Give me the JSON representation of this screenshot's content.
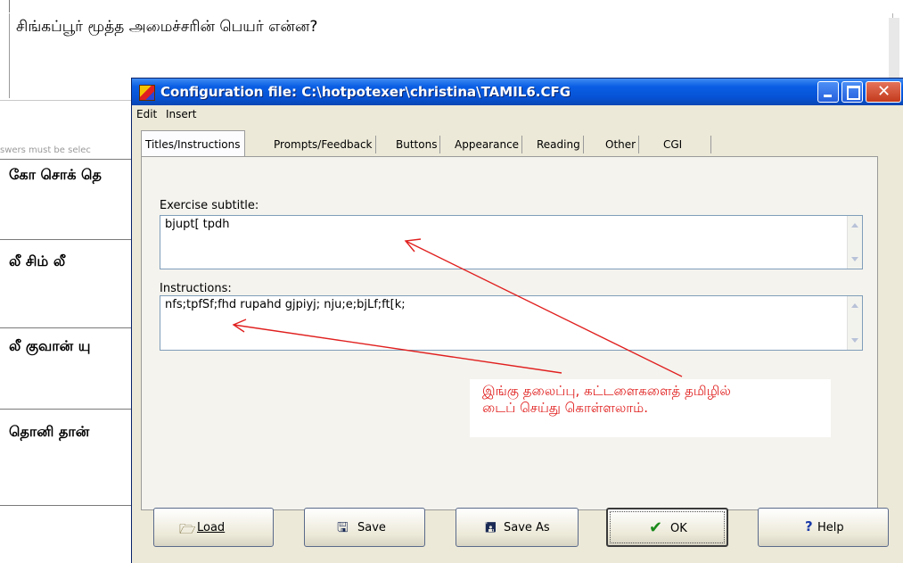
{
  "background_app": {
    "question": "சிங்கப்பூர் மூத்த அமைச்சரின் பெயர் என்ன?",
    "hint": "swers must be selec",
    "answers": [
      "கோ சொக் தெ",
      "லீ சிம் லீ",
      "லீ குவான் யு",
      "தொனி தான்"
    ]
  },
  "dialog": {
    "title": "Configuration file: C:\\hotpotexer\\christina\\TAMIL6.CFG",
    "menu": [
      "Edit",
      "Insert"
    ],
    "tabs": [
      "Titles/Instructions",
      "Prompts/Feedback",
      "Buttons",
      "Appearance",
      "Reading",
      "Other",
      "CGI"
    ],
    "active_tab": "Titles/Instructions",
    "fields": {
      "subtitle_label": "Exercise subtitle:",
      "subtitle_value": "bjupt[ tpdh",
      "instructions_label": "Instructions:",
      "instructions_value": "nfs;tpfSf;fhd rupahd gjpiyj; nju;e;bjLf;ft[k;"
    },
    "buttons": {
      "load": "Load",
      "save": "Save",
      "save_as": "Save As",
      "ok": "OK",
      "help": "Help"
    }
  },
  "annotation": {
    "text": "இங்கு தலைப்பு, கட்டளைகளைத் தமிழில்\nடைப் செய்து கொள்ளலாம்.",
    "color": "#e0201f"
  },
  "icons": {
    "load": "folder-open-icon",
    "save": "floppy-disk-icon",
    "save_as": "floppy-save-as-icon",
    "ok": "checkmark-icon",
    "help": "question-mark-icon"
  },
  "colors": {
    "titlebar": "#0753d6",
    "dialog_bg": "#ece9d8",
    "annotation": "#e0201f"
  }
}
